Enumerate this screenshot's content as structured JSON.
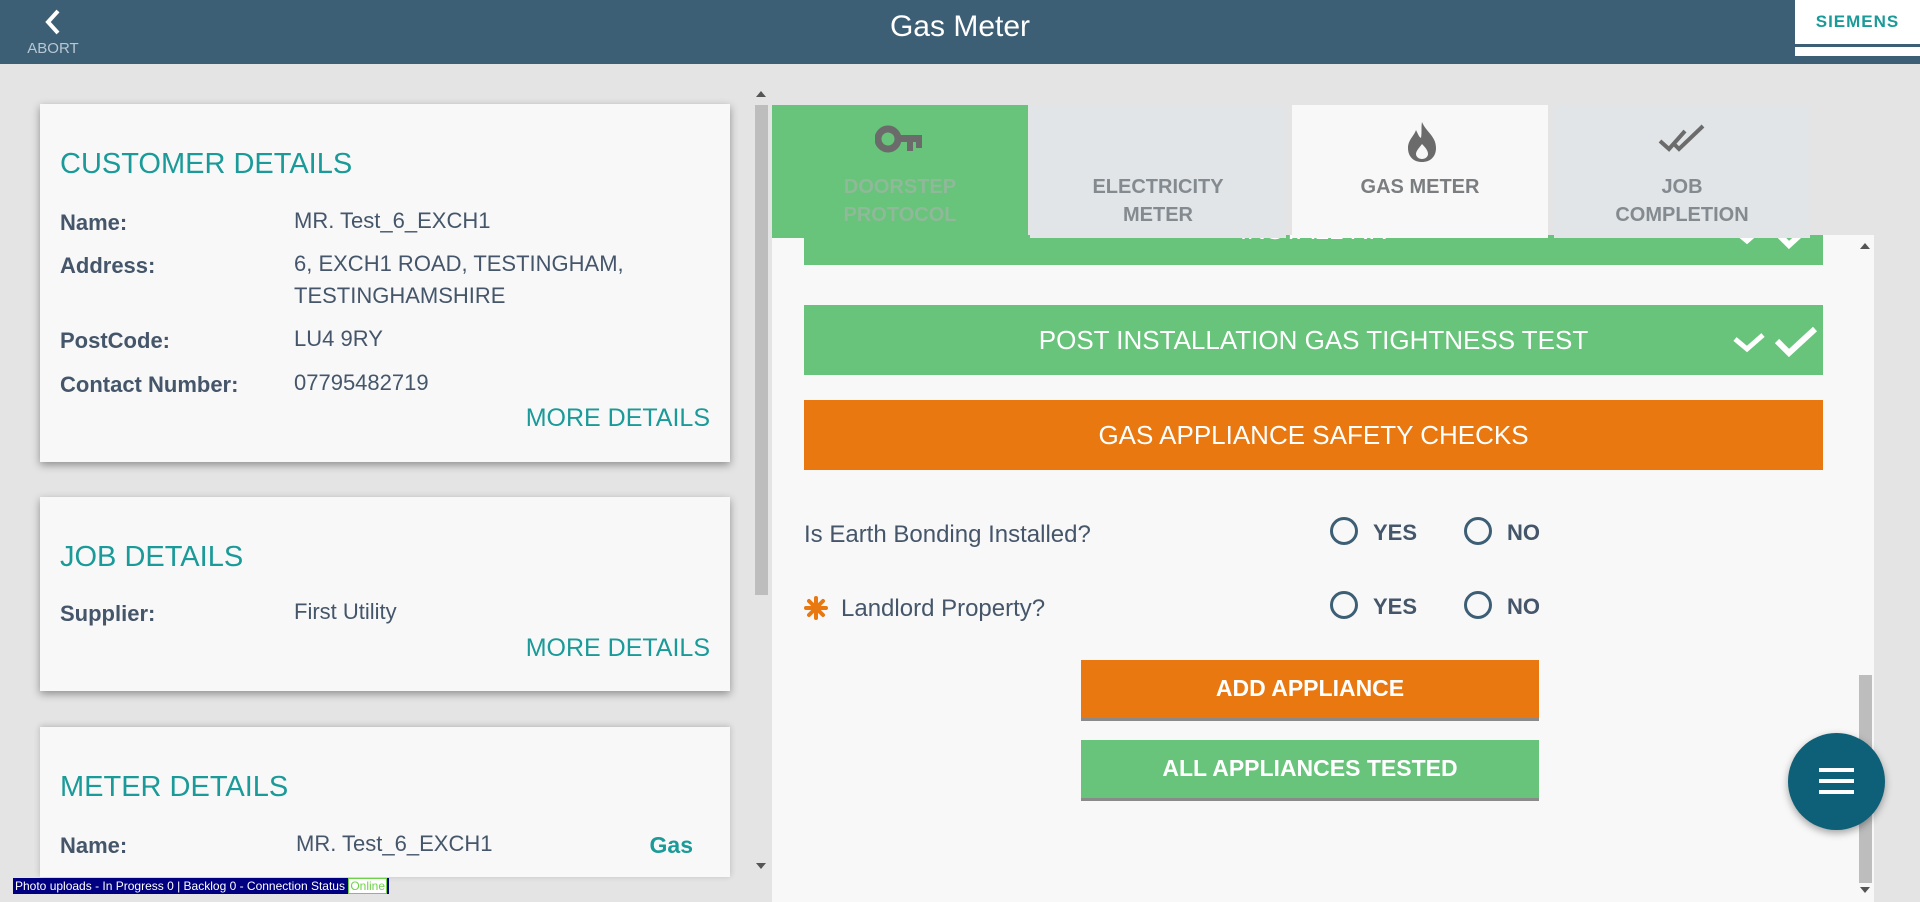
{
  "header": {
    "title": "Gas Meter",
    "abort_label": "ABORT",
    "brand": "SIEMENS"
  },
  "customer_details": {
    "title": "CUSTOMER DETAILS",
    "rows": [
      {
        "label": "Name:",
        "value": "MR. Test_6_EXCH1"
      },
      {
        "label": "Address:",
        "value": "6, EXCH1 ROAD, TESTINGHAM,",
        "value2": "TESTINGHAMSHIRE"
      },
      {
        "label": "PostCode:",
        "value": "LU4 9RY"
      },
      {
        "label": "Contact Number:",
        "value": "07795482719"
      }
    ],
    "more": "MORE DETAILS"
  },
  "job_details": {
    "title": "JOB DETAILS",
    "rows": [
      {
        "label": "Supplier:",
        "value": "First Utility"
      }
    ],
    "more": "MORE DETAILS"
  },
  "meter_details": {
    "title": "METER DETAILS",
    "rows": [
      {
        "label": "Name:",
        "value": "MR. Test_6_EXCH1",
        "tag": "Gas"
      }
    ]
  },
  "steps": [
    {
      "line1": "DOORSTEP",
      "line2": "PROTOCOL",
      "icon": "key-icon",
      "state": "complete"
    },
    {
      "line1": "ELECTRICITY",
      "line2": "METER",
      "icon": "",
      "state": "inactive"
    },
    {
      "line1": "GAS METER",
      "line2": "",
      "icon": "flame-icon",
      "state": "active"
    },
    {
      "line1": "JOB",
      "line2": "COMPLETION",
      "icon": "double-check-icon",
      "state": "inactive"
    }
  ],
  "sections": {
    "install": "INSTALL RR",
    "tightness": "POST INSTALLATION GAS TIGHTNESS TEST",
    "safety": "GAS APPLIANCE SAFETY CHECKS"
  },
  "questions": [
    {
      "text": "Is Earth Bonding Installed?",
      "required": false,
      "yes": "YES",
      "no": "NO"
    },
    {
      "text": "Landlord Property?",
      "required": true,
      "yes": "YES",
      "no": "NO"
    }
  ],
  "buttons": {
    "add_appliance": "ADD APPLIANCE",
    "all_tested": "ALL APPLIANCES TESTED"
  },
  "status_bar": {
    "text": "Photo uploads - In Progress 0 | Backlog 0 - Connection Status",
    "status": "Online"
  },
  "colors": {
    "header": "#3d5f75",
    "teal": "#1a9a98",
    "green": "#67c47a",
    "orange": "#e8780f",
    "fab": "#0e5f78"
  }
}
